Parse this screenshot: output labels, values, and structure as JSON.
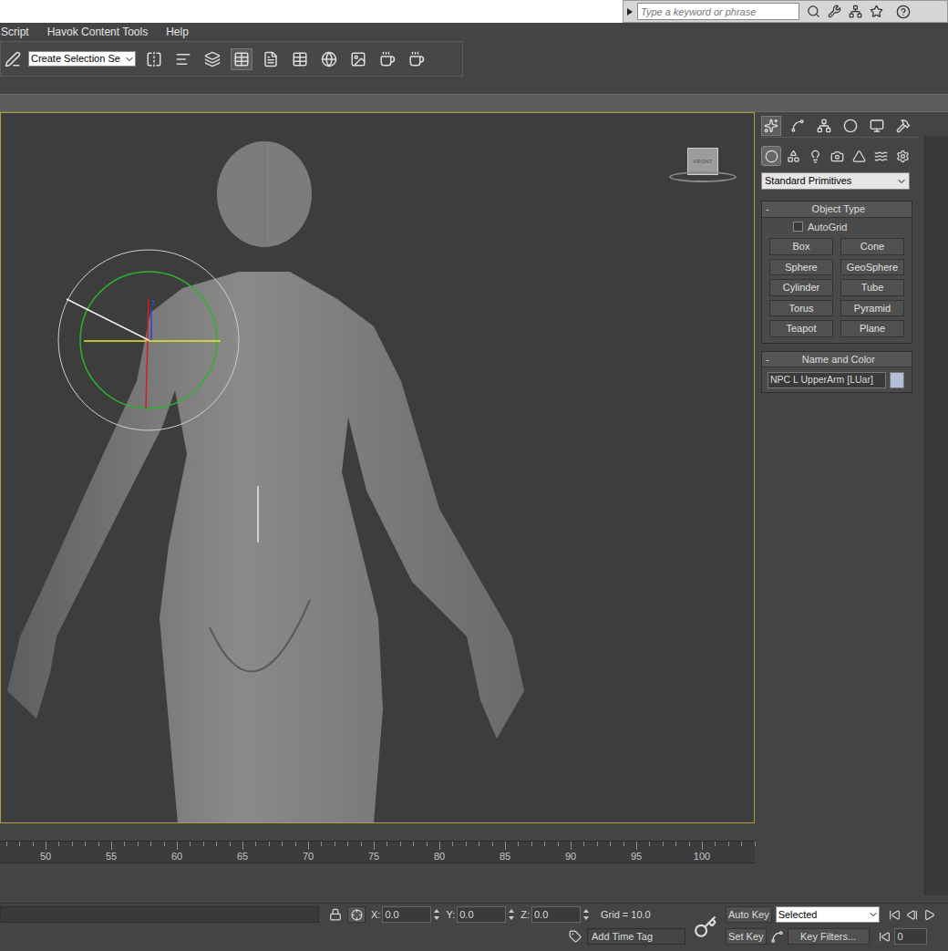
{
  "infocenter": {
    "search_placeholder": "Type a keyword or phrase"
  },
  "menu": [
    "Script",
    "Havok Content Tools",
    "Help"
  ],
  "toolbar": {
    "selection_set": "Create Selection Se"
  },
  "viewport": {
    "viewcube_label": "FRONT",
    "gizmo_axis_label": "z"
  },
  "timeline": {
    "ticks": [
      "50",
      "55",
      "60",
      "65",
      "70",
      "75",
      "80",
      "85",
      "90",
      "95",
      "100"
    ]
  },
  "command_panel": {
    "tabs": [
      {
        "selected": true
      },
      {
        "selected": false
      },
      {
        "selected": false
      },
      {
        "selected": false
      },
      {
        "selected": false
      },
      {
        "selected": false
      }
    ],
    "categories": [
      {
        "selected": true
      },
      {
        "selected": false
      },
      {
        "selected": false
      },
      {
        "selected": false
      },
      {
        "selected": false
      },
      {
        "selected": false
      },
      {
        "selected": false
      }
    ],
    "dropdown": "Standard Primitives",
    "object_type": {
      "collapse": "-",
      "title": "Object Type",
      "autogrid": {
        "label": "AutoGrid",
        "checked": false
      },
      "buttons": [
        "Box",
        "Cone",
        "Sphere",
        "GeoSphere",
        "Cylinder",
        "Tube",
        "Torus",
        "Pyramid",
        "Teapot",
        "Plane"
      ]
    },
    "name_and_color": {
      "collapse": "-",
      "title": "Name and Color",
      "name": "NPC L UpperArm [LUar]",
      "color": "#b3bfd6"
    }
  },
  "status_bar": {
    "coords": [
      {
        "label": "X:",
        "value": "0.0"
      },
      {
        "label": "Y:",
        "value": "0.0"
      },
      {
        "label": "Z:",
        "value": "0.0"
      }
    ],
    "grid": "Grid = 10.0",
    "add_time_tag": "Add Time Tag",
    "auto_key": "Auto Key",
    "key_mode": "Selected",
    "set_key": "Set Key",
    "key_filters": "Key Filters...",
    "frame": "0"
  }
}
